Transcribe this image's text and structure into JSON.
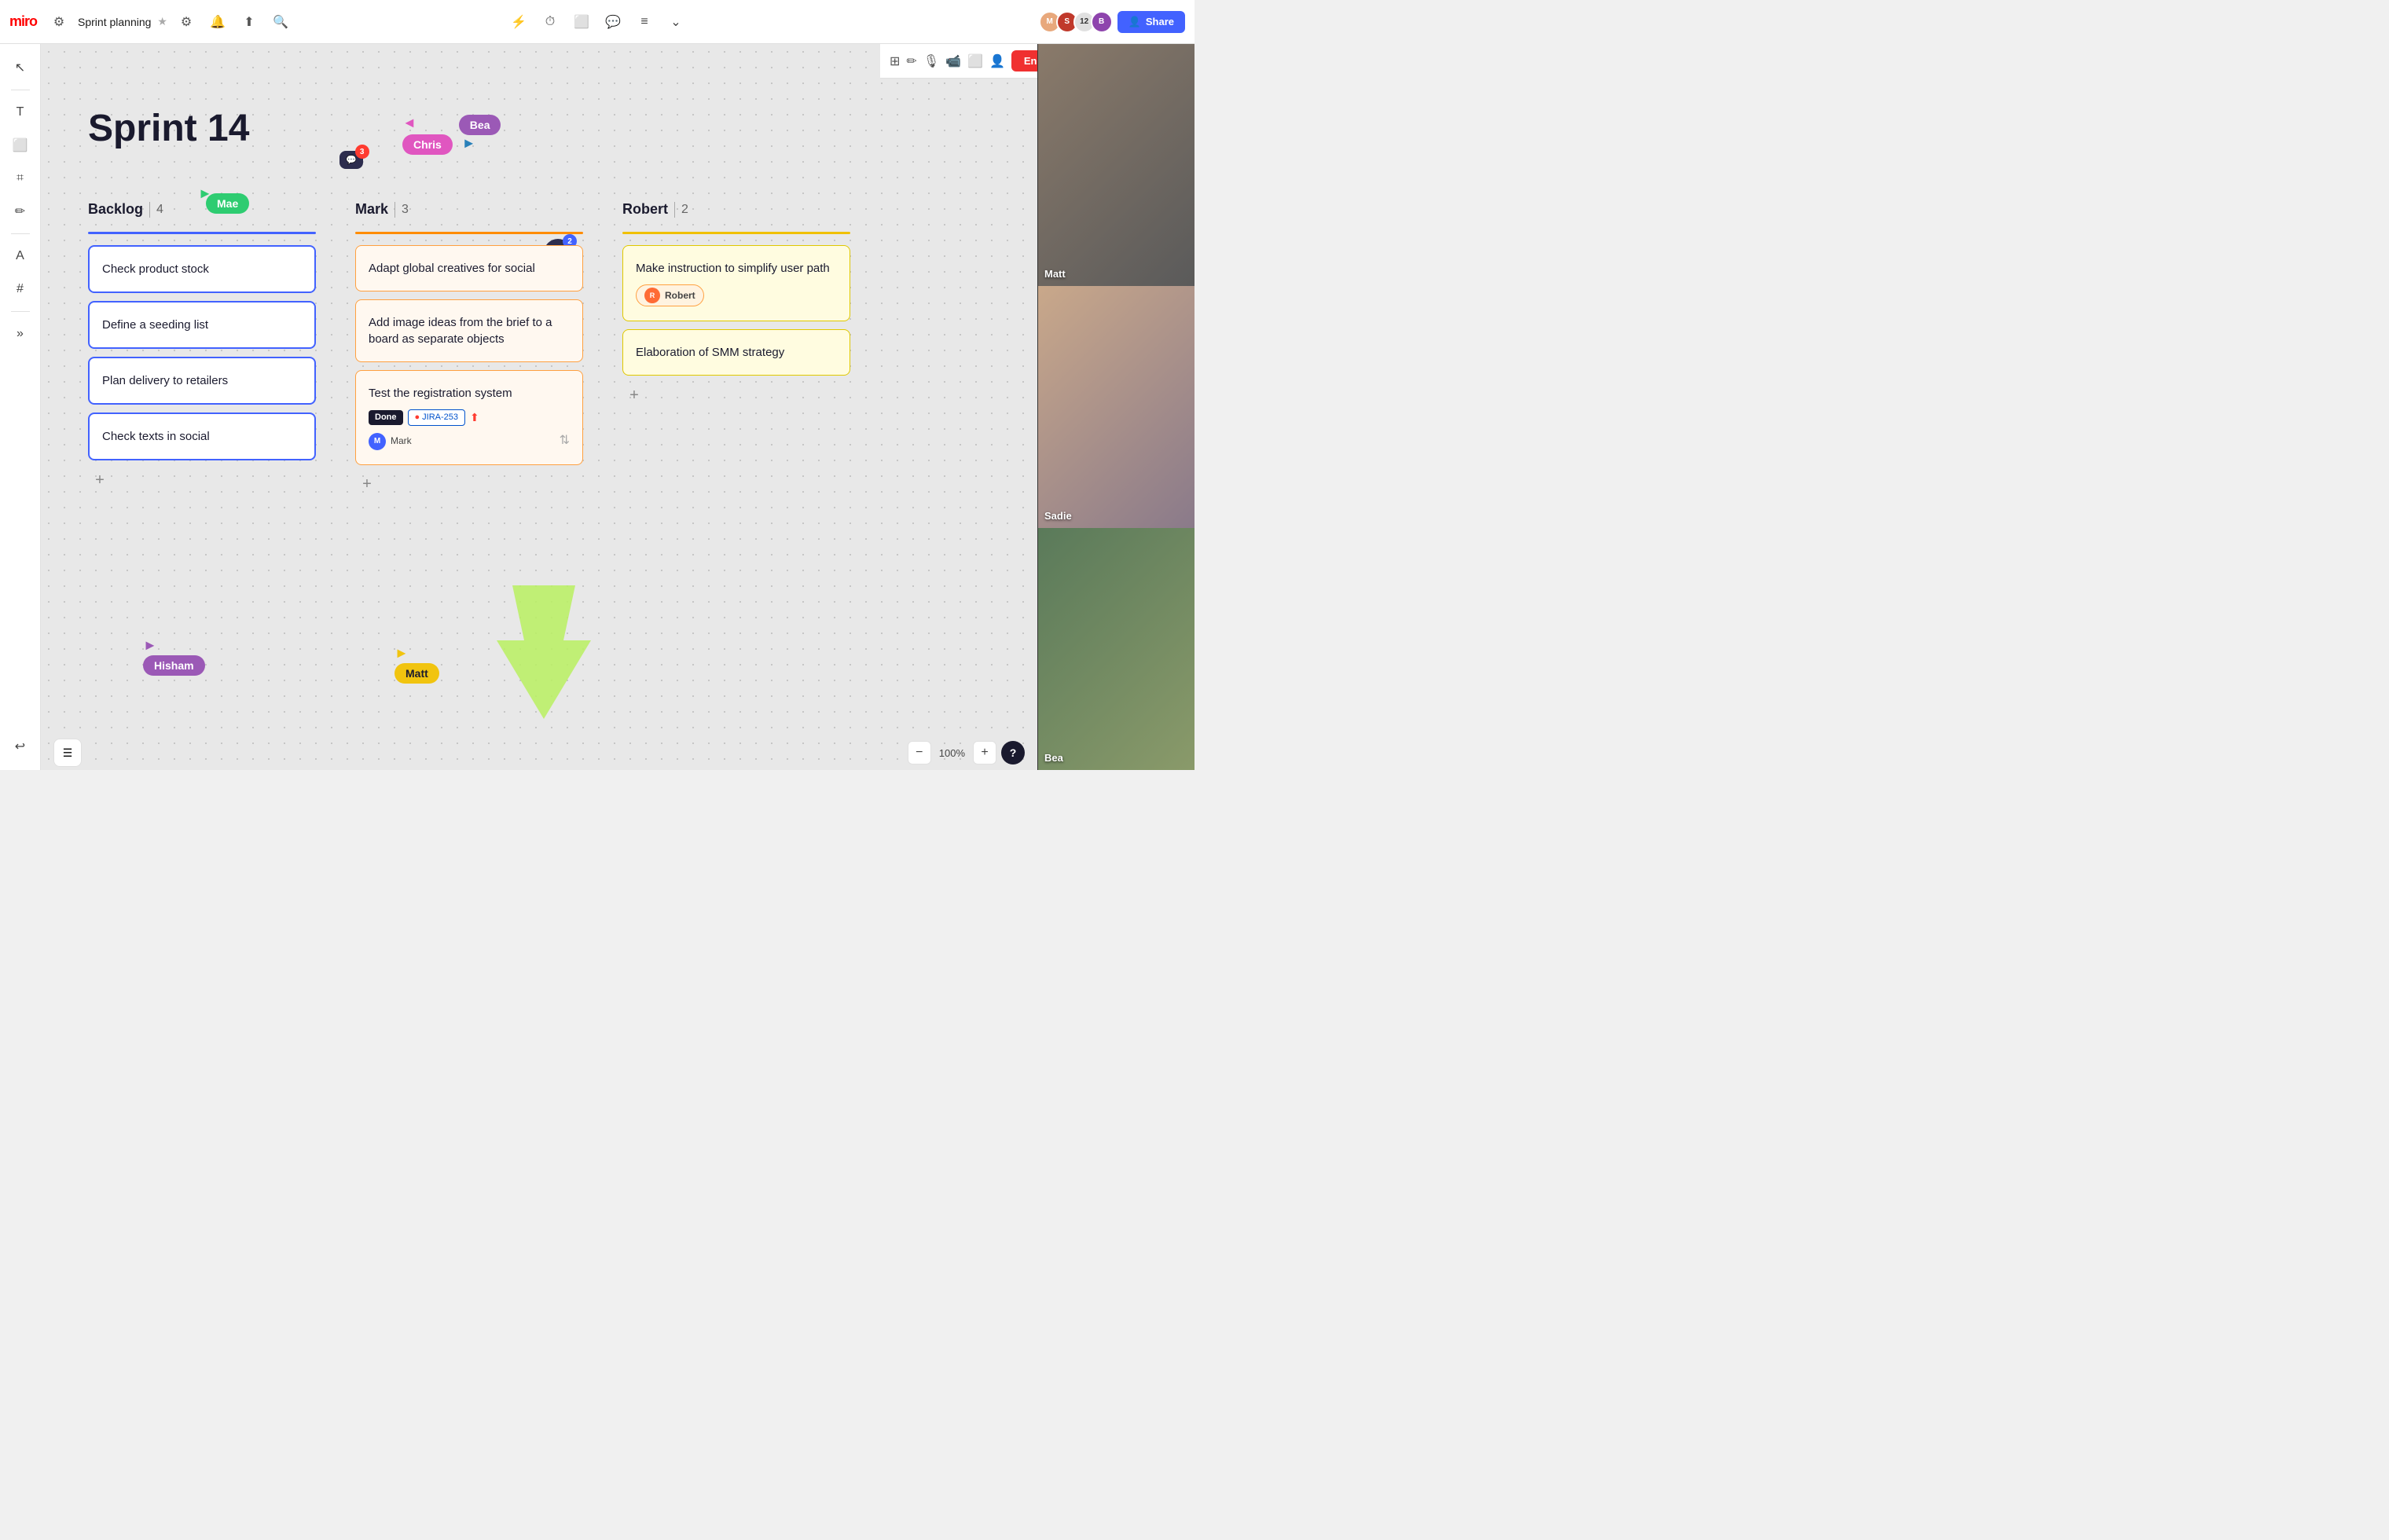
{
  "app": {
    "logo": "miro",
    "board_title": "Sprint planning",
    "star_icon": "★"
  },
  "header": {
    "title": "Sprint planning",
    "share_label": "Share"
  },
  "top_nav": {
    "icons": [
      "⚙",
      "🔔",
      "⬆",
      "🔍"
    ]
  },
  "center_nav": {
    "icons": [
      "⚡",
      "⏱",
      "⬜",
      "💬",
      "≡",
      "⌄"
    ]
  },
  "right_nav": {
    "avatars": [
      {
        "initials": "M",
        "color": "#e8a87c"
      },
      {
        "initials": "S",
        "color": "#c0392b"
      },
      {
        "initials": "B",
        "color": "#8e44ad"
      }
    ],
    "count": "12",
    "extra_avatar_initials": "B",
    "share_label": "Share"
  },
  "second_toolbar": {
    "icons": [
      "⚡",
      "🎙",
      "📹",
      "⬜",
      "👤"
    ],
    "end_label": "End",
    "filter_icon": "⊞",
    "pen_icon": "✏"
  },
  "left_tools": {
    "tools": [
      "↖",
      "T",
      "⬜",
      "⌗",
      "✏",
      "A",
      "#",
      "⋯",
      "↩"
    ]
  },
  "board": {
    "title": "Sprint 14",
    "chat_badge": "3"
  },
  "cursors": {
    "mae": {
      "label": "Mae",
      "color": "#2ecc71",
      "shape": "►"
    },
    "hisham": {
      "label": "Hisham",
      "color": "#9b59b6"
    },
    "matt": {
      "label": "Matt",
      "color": "#f1c40f"
    },
    "bea": {
      "label": "Bea",
      "color": "#9b59b6"
    },
    "chris": {
      "label": "Chris",
      "color": "#e056c0"
    }
  },
  "columns": {
    "backlog": {
      "title": "Backlog",
      "count": "4",
      "color": "#4262ff",
      "cards": [
        {
          "text": "Check product stock"
        },
        {
          "text": "Define a seeding list"
        },
        {
          "text": "Plan delivery to retailers"
        },
        {
          "text": "Check texts in social"
        }
      ]
    },
    "mark": {
      "title": "Mark",
      "count": "3",
      "color": "#ff8c00",
      "cards": [
        {
          "text": "Adapt global creatives for social"
        },
        {
          "text": "Add image ideas from the brief to a board as separate objects"
        },
        {
          "text": "Test the registration system",
          "tag_done": "Done",
          "tag_jira": "JIRA-253",
          "assignee": "Mark"
        }
      ]
    },
    "robert": {
      "title": "Robert",
      "count": "2",
      "color": "#f0c000",
      "cards": [
        {
          "text": "Make instruction to simplify user path",
          "assignee": "Robert"
        },
        {
          "text": "Elaboration of SMM strategy"
        }
      ]
    }
  },
  "notification_bubble": {
    "icon": "💬",
    "count": "2"
  },
  "video_panel": {
    "users": [
      {
        "name": "Matt",
        "class": "video-cell-matt"
      },
      {
        "name": "Sadie",
        "class": "video-cell-sadie"
      },
      {
        "name": "Bea",
        "class": "video-cell-bea"
      }
    ]
  },
  "bottom_bar": {
    "zoom_level": "100%",
    "minus": "−",
    "plus": "+",
    "help": "?"
  }
}
